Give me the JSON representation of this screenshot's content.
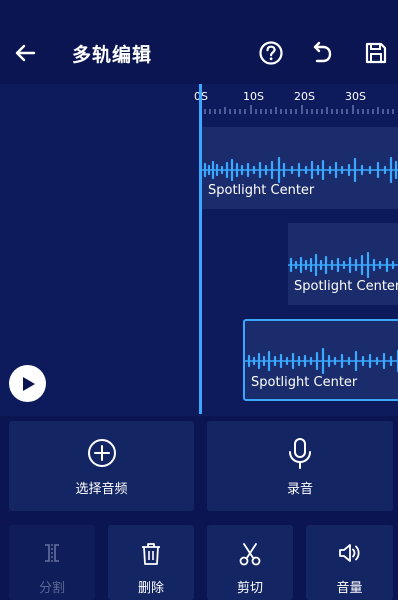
{
  "header": {
    "title": "多轨编辑"
  },
  "ruler": {
    "ticks": [
      "0S",
      "10S",
      "20S",
      "30S"
    ]
  },
  "tracks": [
    {
      "label": "Spotlight Center",
      "selected": false
    },
    {
      "label": "Spotlight Center",
      "selected": false
    },
    {
      "label": "Spotlight Center",
      "selected": true
    }
  ],
  "actions": {
    "select_audio": "选择音频",
    "record": "录音"
  },
  "tools": {
    "split": "分割",
    "delete": "删除",
    "cut": "剪切",
    "volume": "音量"
  },
  "colors": {
    "background": "#0a1552",
    "accent": "#3aa8ff",
    "panel": "#142564"
  }
}
